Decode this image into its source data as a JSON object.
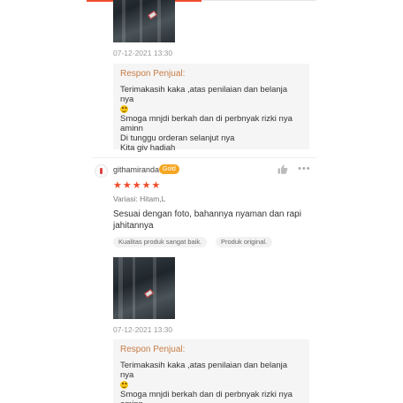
{
  "review_1": {
    "date": "07-12-2021 13:30",
    "seller_reply": {
      "title": "Respon Penjual:",
      "line1": "Terimakasih kaka ,atas penilaian dan belanja nya",
      "line2": "Smoga mnjdi berkah dan di perbnyak rizki nya",
      "line3": "aminn",
      "line4": "Di tunggu orderan selanjut nya",
      "line5": "Kita giv hadiah"
    }
  },
  "review_2": {
    "username": "githamiranda",
    "badge": "Gold",
    "rating": "★★★★★",
    "rating_value": 5,
    "variation": "Variasi: Hitam,L",
    "comment": "Sesuai dengan foto, bahannya nyaman dan rapi jahitannya",
    "tags": [
      "Kualitas produk sangat baik.",
      "Produk original."
    ],
    "date": "07-12-2021 13:30",
    "seller_reply": {
      "title": "Respon Penjual:",
      "line1": "Terimakasih kaka ,atas penilaian dan belanja nya",
      "line2": "Smoga mnjdi berkah dan di perbnyak rizki nya",
      "line3": "aminn"
    }
  },
  "icons": {
    "like": "thumbs-up-icon",
    "more": "more-options-icon",
    "star": "star-icon",
    "emoji": "smiley-emoji-icon"
  },
  "colors": {
    "accent": "#ee4d2d",
    "seller_title": "#c67c46",
    "gold_badge": "#f5a623"
  }
}
